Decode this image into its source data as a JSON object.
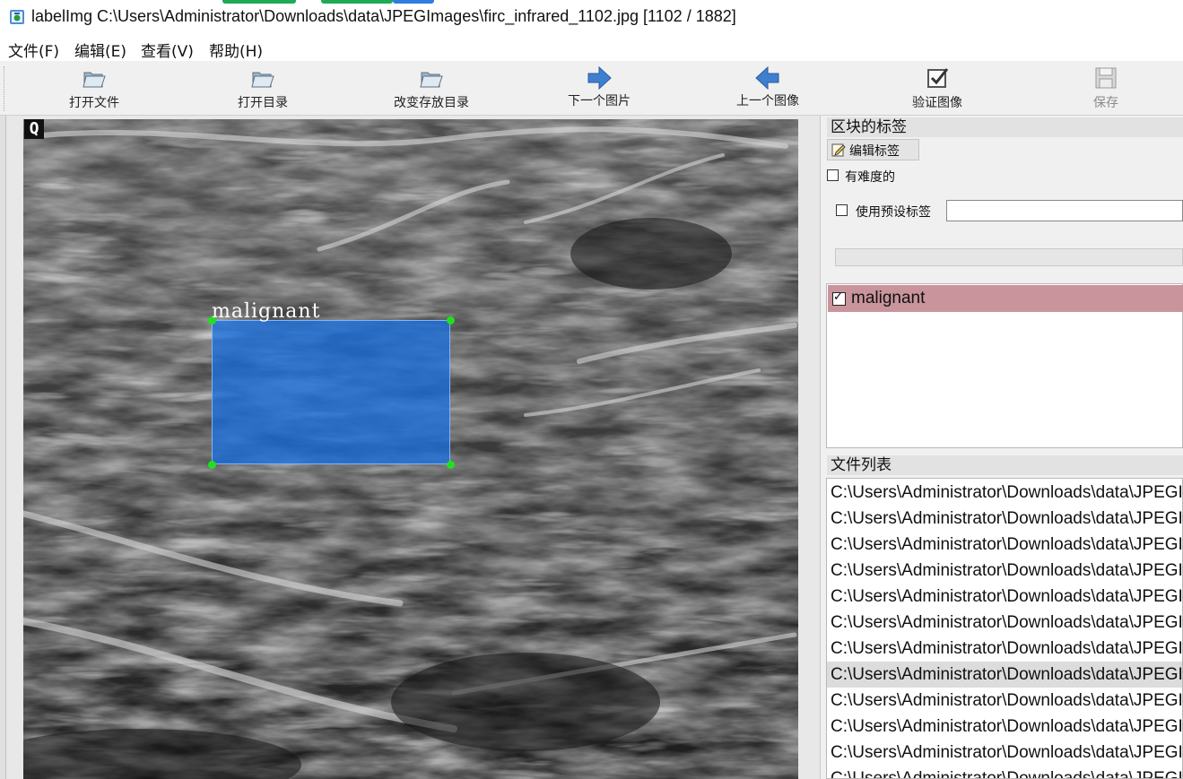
{
  "window": {
    "title": "labelImg C:\\Users\\Administrator\\Downloads\\data\\JPEGImages\\firc_infrared_1102.jpg [1102 / 1882]"
  },
  "menu": {
    "file": "文件(F)",
    "edit": "编辑(E)",
    "view": "查看(V)",
    "help": "帮助(H)"
  },
  "toolbar": {
    "open_file": "打开文件",
    "open_dir": "打开目录",
    "change_save_dir": "改变存放目录",
    "next_image": "下一个图片",
    "prev_image": "上一个图像",
    "verify_image": "验证图像",
    "save": "保存"
  },
  "canvas": {
    "marker": "Q",
    "annotation": {
      "label": "malignant",
      "color": "#1e6fd6"
    }
  },
  "box_labels_panel": {
    "title": "区块的标签",
    "edit_label_button": "编辑标签",
    "difficult_label": "有难度的",
    "difficult_checked": false,
    "use_default_label": "使用预设标签",
    "use_default_checked": false,
    "default_label_value": "",
    "labels": [
      {
        "name": "malignant",
        "checked": true,
        "color": "#c9949c"
      }
    ]
  },
  "file_list_panel": {
    "title": "文件列表",
    "files": [
      "C:\\Users\\Administrator\\Downloads\\data\\JPEGImages",
      "C:\\Users\\Administrator\\Downloads\\data\\JPEGImages",
      "C:\\Users\\Administrator\\Downloads\\data\\JPEGImages",
      "C:\\Users\\Administrator\\Downloads\\data\\JPEGImages",
      "C:\\Users\\Administrator\\Downloads\\data\\JPEGImages",
      "C:\\Users\\Administrator\\Downloads\\data\\JPEGImages",
      "C:\\Users\\Administrator\\Downloads\\data\\JPEGImages",
      "C:\\Users\\Administrator\\Downloads\\data\\JPEGImages",
      "C:\\Users\\Administrator\\Downloads\\data\\JPEGImages",
      "C:\\Users\\Administrator\\Downloads\\data\\JPEGImages",
      "C:\\Users\\Administrator\\Downloads\\data\\JPEGImages",
      "C:\\Users\\Administrator\\Downloads\\data\\JPEGImages"
    ],
    "selected_index": 7
  }
}
